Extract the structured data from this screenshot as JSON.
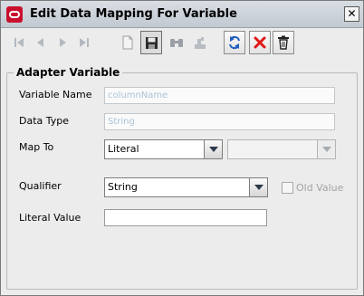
{
  "window": {
    "title": "Edit Data Mapping For Variable",
    "close_label": "✕"
  },
  "toolbar": {
    "icons": [
      "first-record-icon",
      "previous-record-icon",
      "next-record-icon",
      "last-record-icon",
      "new-document-icon",
      "save-icon",
      "find-icon",
      "bulk-edit-icon",
      "refresh-icon",
      "delete-icon",
      "trash-icon"
    ]
  },
  "adapter_variable": {
    "group_title": "Adapter Variable",
    "variable_name_label": "Variable Name",
    "variable_name_value": "columnName",
    "data_type_label": "Data Type",
    "data_type_value": "String",
    "map_to_label": "Map To",
    "map_to_value": "Literal",
    "map_to_secondary_value": "",
    "qualifier_label": "Qualifier",
    "qualifier_value": "String",
    "old_value_label": "Old Value",
    "old_value_checked": false,
    "literal_value_label": "Literal Value",
    "literal_value": ""
  },
  "colors": {
    "delete_red": "#e01818",
    "refresh_blue": "#1f5fbf",
    "disabled_text": "#a9c3d6"
  }
}
